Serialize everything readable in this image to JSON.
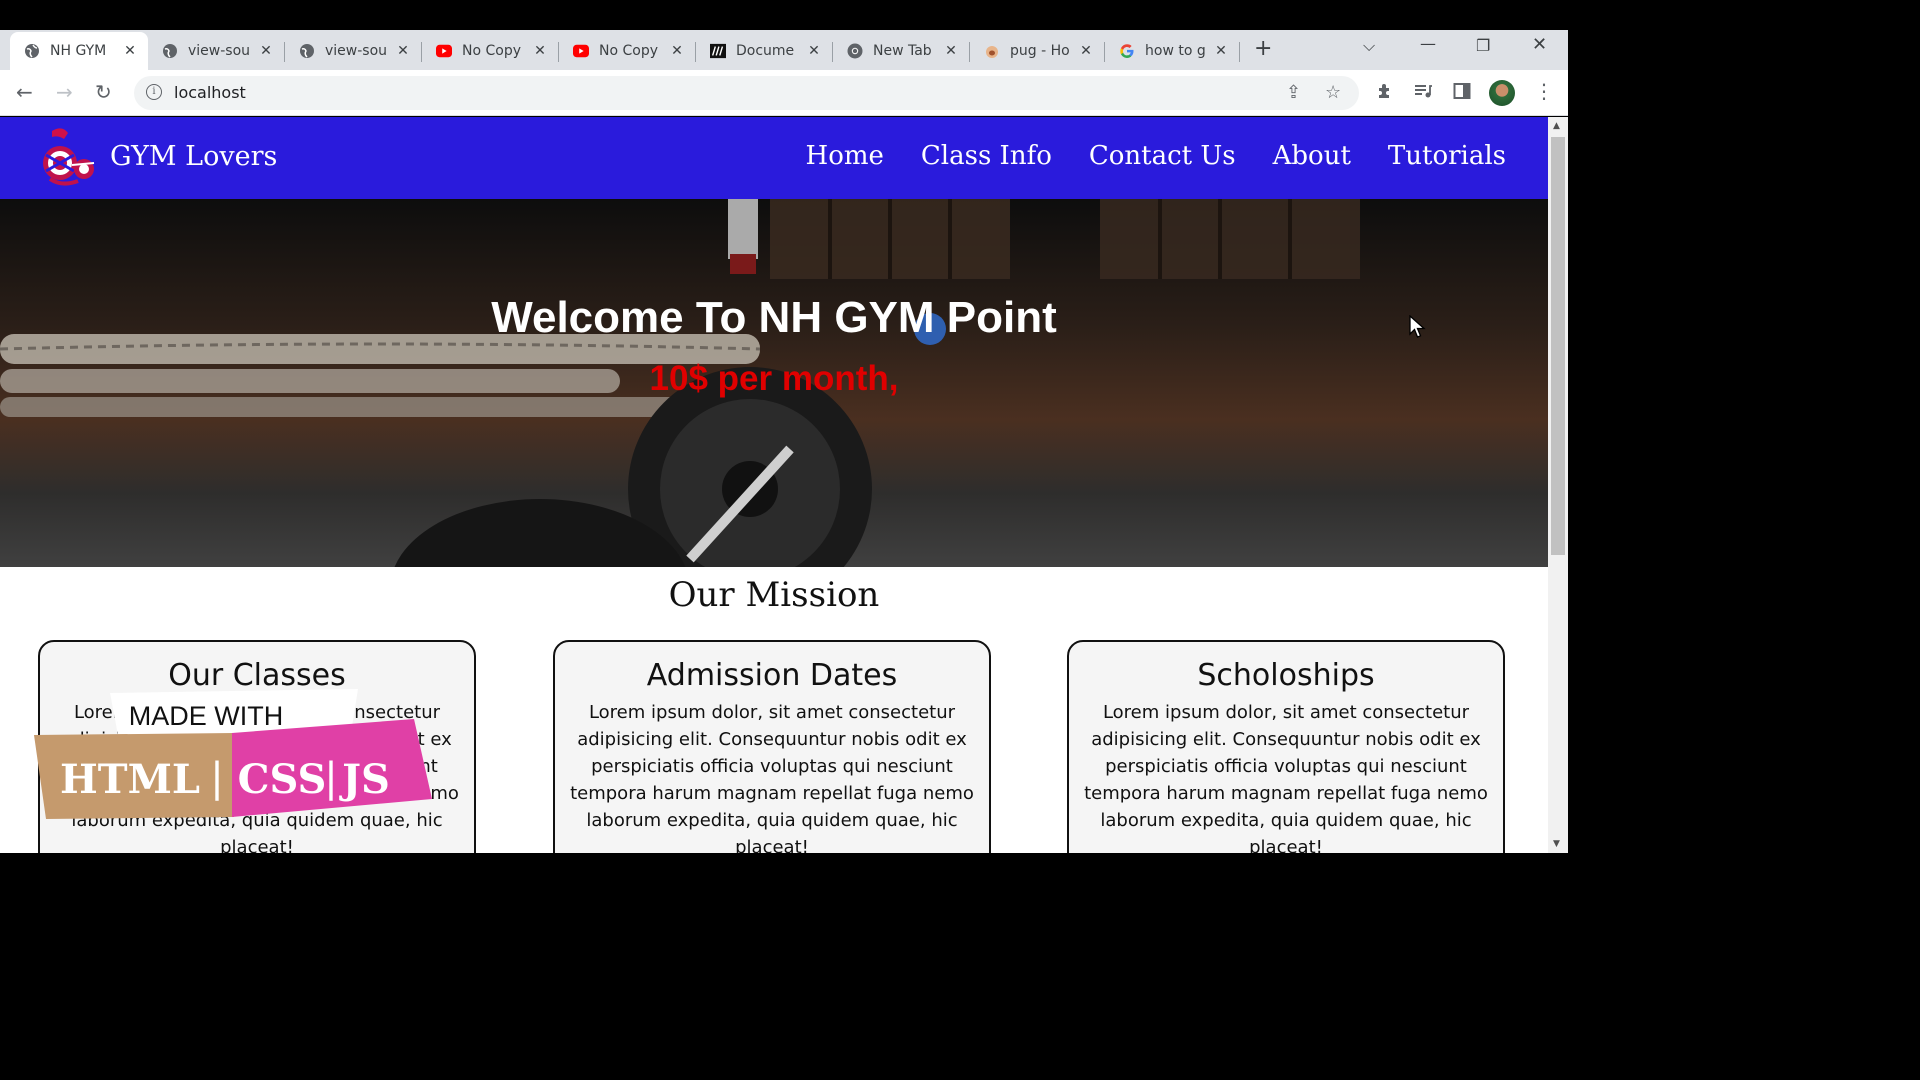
{
  "browser": {
    "tabs": [
      {
        "title": "NH GYM",
        "active": true,
        "icon": "globe-icon"
      },
      {
        "title": "view-sou",
        "icon": "globe-icon"
      },
      {
        "title": "view-sou",
        "icon": "globe-icon"
      },
      {
        "title": "No Copy",
        "icon": "youtube-icon"
      },
      {
        "title": "No Copy",
        "icon": "youtube-icon"
      },
      {
        "title": "Docume",
        "icon": "mdn-icon"
      },
      {
        "title": "New Tab",
        "icon": "chrome-icon"
      },
      {
        "title": "pug - Ho",
        "icon": "pug-icon"
      },
      {
        "title": "how to g",
        "icon": "google-icon"
      }
    ],
    "url": "localhost"
  },
  "site": {
    "brand": "GYM Lovers",
    "nav": [
      "Home",
      "Class Info",
      "Contact Us",
      "About",
      "Tutorials"
    ],
    "hero_title": "Welcome To NH GYM Point",
    "hero_subtitle": "10$ per month,",
    "mission_title": "Our Mission",
    "cards": [
      {
        "title": "Our Classes",
        "body": "Lorem ipsum dolor, sit amet consectetur adipisicing elit. Consequuntur nobis odit ex perspiciatis officia voluptas qui nesciunt tempora harum magnam repellat fuga nemo laborum expedita, quia quidem quae, hic placeat!"
      },
      {
        "title": "Admission Dates",
        "body": "Lorem ipsum dolor, sit amet consectetur adipisicing elit. Consequuntur nobis odit ex perspiciatis officia voluptas qui nesciunt tempora harum magnam repellat fuga nemo laborum expedita, quia quidem quae, hic placeat!"
      },
      {
        "title": "Scholoships",
        "body": "Lorem ipsum dolor, sit amet consectetur adipisicing elit. Consequuntur nobis odit ex perspiciatis officia voluptas qui nesciunt tempora harum magnam repellat fuga nemo laborum expedita, quia quidem quae, hic placeat!"
      }
    ],
    "badge": {
      "top": "MADE WITH",
      "html": "HTML",
      "css": "CSS",
      "js": "JS"
    }
  },
  "colors": {
    "nav_bg": "#2a1bdc",
    "price": "#e00000"
  }
}
